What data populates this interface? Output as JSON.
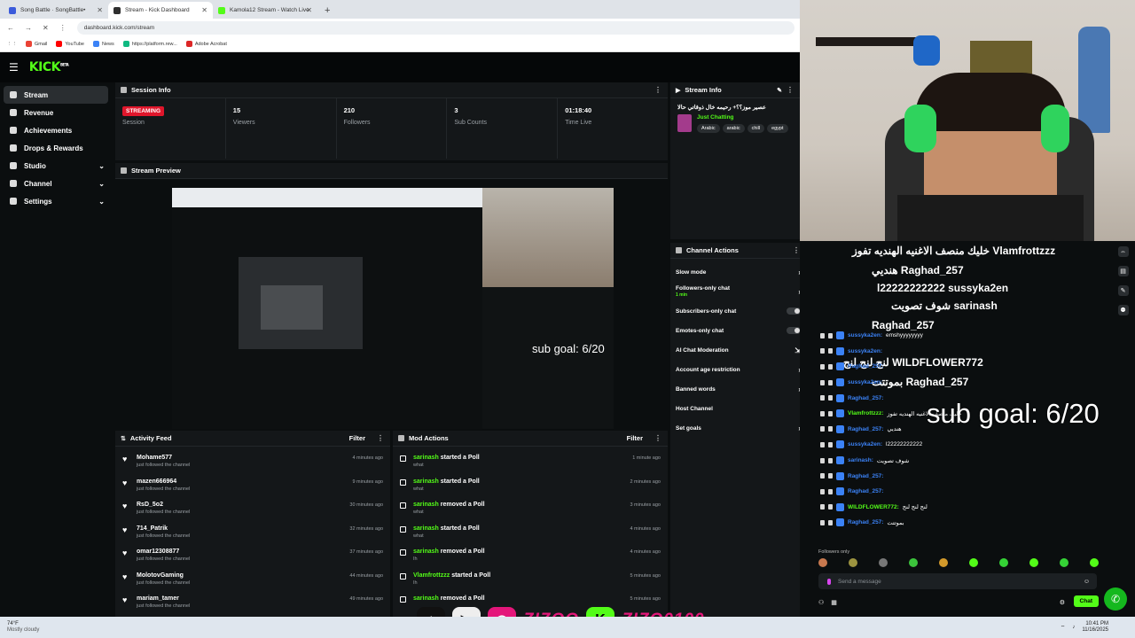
{
  "browser": {
    "tabs": [
      {
        "title": "Song Battle · SongBattle•",
        "color": "#3b5bdb",
        "active": false
      },
      {
        "title": "Stream - Kick Dashboard",
        "color": "#2f2f2f",
        "active": true
      },
      {
        "title": "Kamola12 Stream - Watch Live",
        "color": "#53fc18",
        "active": false
      }
    ],
    "url": "dashboard.kick.com/stream",
    "bookmarks": [
      {
        "label": "Gmail",
        "color": "#ea4335"
      },
      {
        "label": "YouTube",
        "color": "#ff0000"
      },
      {
        "label": "News",
        "color": "#3b82f6"
      },
      {
        "label": "https://platform.rew...",
        "color": "#10b981"
      },
      {
        "label": "Adobe Acrobat",
        "color": "#dc2626"
      }
    ]
  },
  "brand": {
    "logo": "KICK",
    "beta": "BETA",
    "accent": "#53fc18"
  },
  "nav": [
    {
      "label": "Stream",
      "active": true,
      "chevron": false
    },
    {
      "label": "Revenue",
      "active": false,
      "chevron": false
    },
    {
      "label": "Achievements",
      "active": false,
      "chevron": false
    },
    {
      "label": "Drops & Rewards",
      "active": false,
      "chevron": false
    },
    {
      "label": "Studio",
      "active": false,
      "chevron": true
    },
    {
      "label": "Channel",
      "active": false,
      "chevron": true
    },
    {
      "label": "Settings",
      "active": false,
      "chevron": true
    }
  ],
  "session": {
    "title": "Session Info",
    "status_badge": "STREAMING",
    "session_label": "Session",
    "viewers": "15",
    "viewers_label": "Viewers",
    "followers": "210",
    "followers_label": "Followers",
    "subs": "3",
    "subs_label": "Sub Counts",
    "time": "01:18:40",
    "time_label": "Time Live"
  },
  "preview": {
    "title": "Stream Preview",
    "sub_goal_text": "sub goal: 6/20"
  },
  "stream_info": {
    "title": "Stream Info",
    "stream_title": "عصير موز؟؟+ رحيمه خال ذوقاتي حالا",
    "category": "Just Chatting",
    "tags": [
      "Arabic",
      "arabic",
      "chill",
      "egypt"
    ]
  },
  "channel_actions": {
    "title": "Channel Actions",
    "items": [
      {
        "label": "Slow mode",
        "sub": "",
        "control": "arrow"
      },
      {
        "label": "Followers-only chat",
        "sub": "1 min",
        "control": "arrow"
      },
      {
        "label": "Subscribers-only chat",
        "sub": "",
        "control": "toggle"
      },
      {
        "label": "Emotes-only chat",
        "sub": "",
        "control": "toggle"
      },
      {
        "label": "AI Chat Moderation",
        "sub": "",
        "control": "external"
      },
      {
        "label": "Account age restriction",
        "sub": "",
        "control": "arrow"
      },
      {
        "label": "Banned words",
        "sub": "",
        "control": "arrow"
      },
      {
        "label": "Host Channel",
        "sub": "",
        "control": "none"
      },
      {
        "label": "Set goals",
        "sub": "",
        "control": "arrow"
      }
    ]
  },
  "activity": {
    "title": "Activity Feed",
    "filter": "Filter",
    "items": [
      {
        "user": "Mohame577",
        "action": "just followed the channel",
        "time": "4 minutes ago"
      },
      {
        "user": "mazen666964",
        "action": "just followed the channel",
        "time": "9 minutes ago"
      },
      {
        "user": "RsD_5o2",
        "action": "just followed the channel",
        "time": "30 minutes ago"
      },
      {
        "user": "714_Patrik",
        "action": "just followed the channel",
        "time": "32 minutes ago"
      },
      {
        "user": "omar12308877",
        "action": "just followed the channel",
        "time": "37 minutes ago"
      },
      {
        "user": "MolotovGaming",
        "action": "just followed the channel",
        "time": "44 minutes ago"
      },
      {
        "user": "mariam_tamer",
        "action": "just followed the channel",
        "time": "49 minutes ago"
      }
    ]
  },
  "mod": {
    "title": "Mod Actions",
    "filter": "Filter",
    "items": [
      {
        "user": "sarinash",
        "action": "started a Poll",
        "detail": "what",
        "time": "1 minute ago"
      },
      {
        "user": "sarinash",
        "action": "started a Poll",
        "detail": "what",
        "time": "2 minutes ago"
      },
      {
        "user": "sarinash",
        "action": "removed a Poll",
        "detail": "what",
        "time": "3 minutes ago"
      },
      {
        "user": "sarinash",
        "action": "started a Poll",
        "detail": "what",
        "time": "4 minutes ago"
      },
      {
        "user": "sarinash",
        "action": "removed a Poll",
        "detail": "Ih",
        "time": "4 minutes ago"
      },
      {
        "user": "Vlamfrottzzz",
        "action": "started a Poll",
        "detail": "Ih",
        "time": "5 minutes ago"
      },
      {
        "user": "sarinash",
        "action": "removed a Poll",
        "detail": "",
        "time": "5 minutes ago"
      }
    ]
  },
  "chat_overlay_big": [
    {
      "text": "خليك منصف الاغنيه الهنديه تفوز  Vlamfrottzzz",
      "color": "#ffffff"
    },
    {
      "text": "هنديي  Raghad_257",
      "color": "#ffffff"
    },
    {
      "text": "l22222222222  sussyka2en",
      "color": "#ffffff"
    },
    {
      "text": "شوف تصويت  sarinash",
      "color": "#ffffff"
    },
    {
      "text": "Raghad_257",
      "color": "#ffffff"
    },
    {
      "text": "لنج لنج لنج  WILDFLOWER772",
      "color": "#ffffff"
    },
    {
      "text": "بموتتت  Raghad_257",
      "color": "#ffffff"
    }
  ],
  "chat": {
    "messages": [
      {
        "user": "sussyka2en:",
        "text": "emshyyyyyyyy",
        "color": "#3b82f6"
      },
      {
        "user": "sussyka2en:",
        "text": "",
        "color": "#3b82f6"
      },
      {
        "user": "Raghad_257:",
        "text": "",
        "color": "#3b82f6"
      },
      {
        "user": "sussyka2en:",
        "text": "",
        "color": "#3b82f6"
      },
      {
        "user": "Raghad_257:",
        "text": "",
        "color": "#3b82f6"
      },
      {
        "user": "Vlamfrottzzz:",
        "text": "خليك منصف الاغنيه الهنديه تفوز",
        "color": "#53fc18"
      },
      {
        "user": "Raghad_257:",
        "text": "هنديي",
        "color": "#3b82f6"
      },
      {
        "user": "sussyka2en:",
        "text": "l22222222222",
        "color": "#3b82f6"
      },
      {
        "user": "sarinash:",
        "text": "شوف تصويت",
        "color": "#3b82f6"
      },
      {
        "user": "Raghad_257:",
        "text": "",
        "color": "#3b82f6"
      },
      {
        "user": "Raghad_257:",
        "text": "",
        "color": "#3b82f6"
      },
      {
        "user": "WILDFLOWER772:",
        "text": "لنج لنج لنج",
        "color": "#53fc18"
      },
      {
        "user": "Raghad_257:",
        "text": "بموتتت",
        "color": "#3b82f6"
      }
    ],
    "followers_only": "Followers only",
    "placeholder": "Send a message",
    "send_label": "Chat"
  },
  "sub_goal": "sub goal: 6/20",
  "social": {
    "handle1": "ZIZOO",
    "handle2": "ZIZO0100"
  },
  "taskbar": {
    "temp": "74°F",
    "weather": "Mostly cloudy",
    "time": "10:41 PM",
    "date": "11/16/2025"
  }
}
